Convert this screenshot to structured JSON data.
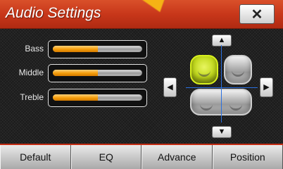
{
  "header": {
    "title": "Audio Settings",
    "close_label": "✕"
  },
  "sliders": [
    {
      "label": "Bass",
      "level": 0.5
    },
    {
      "label": "Middle",
      "level": 0.5
    },
    {
      "label": "Treble",
      "level": 0.5
    }
  ],
  "balance": {
    "up_arrow": "▲",
    "down_arrow": "▼",
    "left_arrow": "◀",
    "right_arrow": "▶",
    "active_seat": "front-left"
  },
  "tabs": [
    {
      "label": "Default"
    },
    {
      "label": "EQ"
    },
    {
      "label": "Advance"
    },
    {
      "label": "Position"
    }
  ],
  "colors": {
    "title_bar": "#c8371a",
    "slider_fill": "#f59d0a",
    "active_seat": "#c0d81a",
    "crosshair": "#2a70e0"
  }
}
